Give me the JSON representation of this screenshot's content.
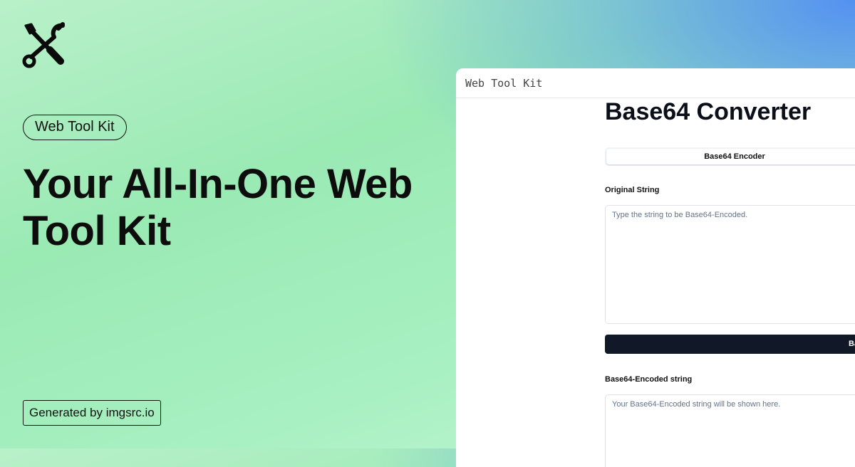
{
  "brand": {
    "logo_icon": "tools-icon",
    "pill_label": "Web Tool Kit",
    "headline": "Your All-In-One Web Tool Kit",
    "generated_label": "Generated by imgsrc.io"
  },
  "window": {
    "title": "Web Tool Kit",
    "app_title": "Base64 Converter",
    "tab_label": "Base64 Encoder",
    "original_label": "Original String",
    "original_placeholder": "Type the string to be Base64-Encoded.",
    "button_label": "Base",
    "encoded_label": "Base64-Encoded string",
    "encoded_placeholder": "Your Base64-Encoded string will be shown here."
  },
  "colors": {
    "accent_dark": "#111827",
    "background_green": "#9aeab4",
    "background_blue": "#508cf5"
  }
}
